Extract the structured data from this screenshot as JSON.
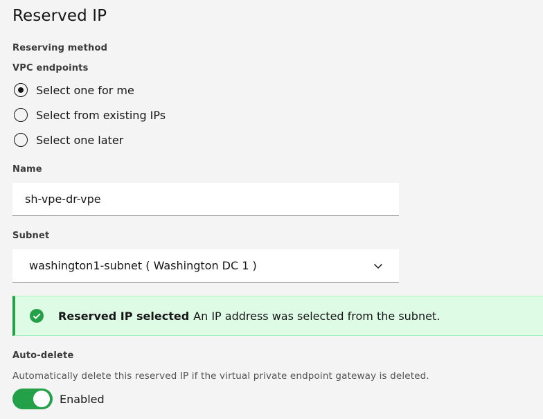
{
  "page": {
    "title": "Reserved IP"
  },
  "reserving_method": {
    "label": "Reserving method",
    "sublabel": "VPC endpoints",
    "options": [
      {
        "label": "Select one for me",
        "checked": true
      },
      {
        "label": "Select from existing IPs",
        "checked": false
      },
      {
        "label": "Select one later",
        "checked": false
      }
    ]
  },
  "name_field": {
    "label": "Name",
    "value": "sh-vpe-dr-vpe"
  },
  "subnet_field": {
    "label": "Subnet",
    "value": "washington1-subnet ( Washington DC 1 )"
  },
  "notification": {
    "title": "Reserved IP selected",
    "message": "An IP address was selected from the subnet.",
    "status": "success",
    "icon": "checkmark-filled-icon"
  },
  "auto_delete": {
    "label": "Auto-delete",
    "helper": "Automatically delete this reserved IP if the virtual private endpoint gateway is deleted.",
    "toggle_label": "Enabled",
    "enabled": true
  },
  "colors": {
    "success": "#24a148",
    "success_bg": "#defbe6",
    "page_bg": "#f4f4f4",
    "field_bg": "#ffffff"
  }
}
